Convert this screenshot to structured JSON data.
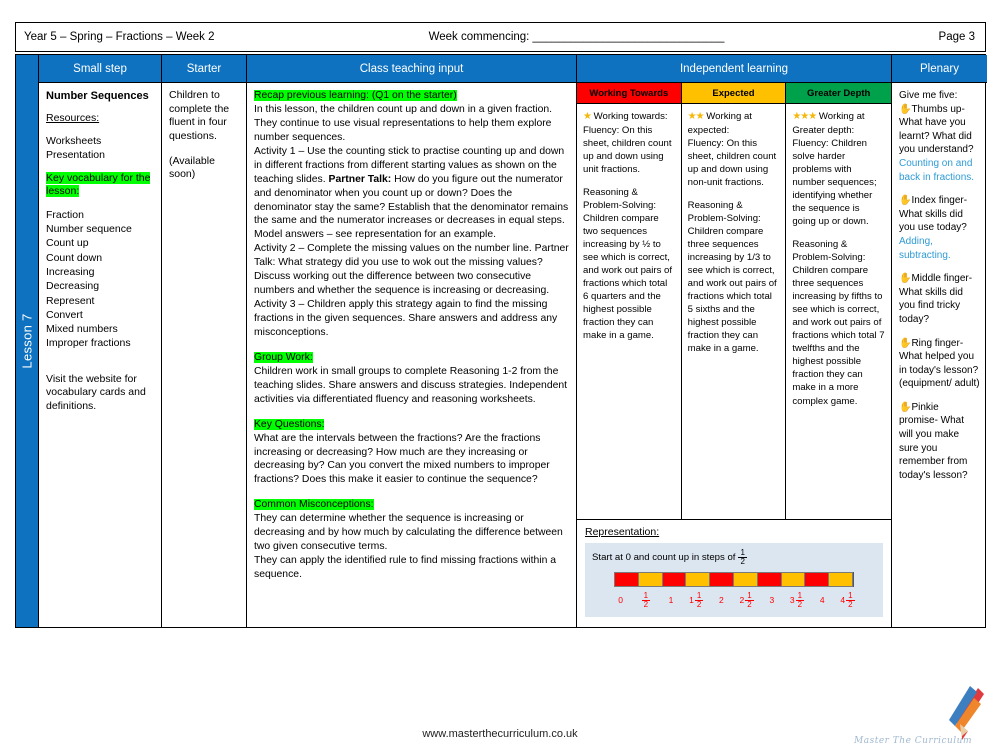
{
  "header": {
    "title": "Year 5 – Spring – Fractions – Week 2",
    "week_commencing": "Week commencing: ______________________________",
    "page": "Page 3"
  },
  "lesson_tab": "Lesson 7",
  "columns": {
    "small_step": "Small step",
    "starter": "Starter",
    "class_teaching_input": "Class teaching input",
    "independent_learning": "Independent learning",
    "plenary": "Plenary"
  },
  "small_step": {
    "title": "Number Sequences",
    "resources_label": "Resources:",
    "resources": [
      "Worksheets",
      "Presentation"
    ],
    "key_vocab_label": "Key vocabulary for the lesson:",
    "vocabulary": [
      "Fraction",
      "Number sequence",
      "Count up",
      "Count down",
      "Increasing",
      "Decreasing",
      "Represent",
      "Convert",
      "Mixed numbers",
      "Improper fractions"
    ],
    "visit_note": "Visit the website for vocabulary cards and definitions."
  },
  "starter": {
    "line1": "Children to complete the fluent in four questions.",
    "line2": "(Available soon)"
  },
  "class_teaching_input": {
    "recap_label": "Recap previous learning: (Q1 on the starter)",
    "intro": "In this lesson, the children count up and down in a given fraction. They continue to use visual representations to help them explore number sequences.",
    "activity1_a": "Activity 1 – Use the counting stick to practise counting up and down in different fractions from different starting values as shown on the teaching slides. ",
    "activity1_bold": "Partner Talk:",
    "activity1_b": " How do you figure out the numerator and denominator when you count up or down? Does the denominator stay the same? Establish that the denominator remains the same and the numerator increases or decreases in equal steps.",
    "model_answers": "Model answers – see representation for an example.",
    "activity2": "Activity 2 – Complete the missing values on the number line. Partner Talk: What strategy did you use to wok out the missing values? Discuss working out the difference between two consecutive numbers and whether the sequence is increasing or decreasing.",
    "activity3": "Activity 3 – Children apply this strategy again to find the missing fractions in the given sequences. Share answers and address any misconceptions.",
    "group_work_label": "Group Work:",
    "group_work": "Children work in small groups to complete Reasoning 1-2 from the teaching slides. Share answers and discuss strategies. Independent activities via differentiated fluency and reasoning worksheets.",
    "key_questions_label": "Key Questions:",
    "key_questions": "What are the intervals between the fractions? Are the fractions increasing or decreasing? How much are they increasing or decreasing by? Can you convert the mixed numbers to improper fractions? Does this make it easier to continue the sequence?",
    "misconceptions_label": "Common Misconceptions:",
    "misconceptions_1": "They can determine whether the sequence is increasing or decreasing and by how much by calculating the difference between two given consecutive terms.",
    "misconceptions_2": "They can apply the identified rule to find missing fractions within a sequence."
  },
  "independent_learning": {
    "columns": [
      {
        "header": "Working Towards",
        "header_bg": "#FF0000",
        "stars": "★",
        "heading": "Working towards:",
        "fluency": "Fluency: On this sheet, children count up and down using unit fractions.",
        "reasoning": "Reasoning & Problem-Solving: Children compare two sequences increasing by ½ to see which is correct, and work out pairs of fractions which total 6 quarters and the highest possible fraction they can make in a game."
      },
      {
        "header": "Expected",
        "header_bg": "#FFC000",
        "stars": "★★",
        "heading": "Working at expected:",
        "fluency": "Fluency: On this sheet, children count up and down using non-unit fractions.",
        "reasoning": "Reasoning & Problem-Solving: Children compare three sequences increasing by 1/3 to see which is correct, and work out pairs of fractions which total 5 sixths and the highest possible fraction they can make in a game."
      },
      {
        "header": "Greater Depth",
        "header_bg": "#00A14B",
        "stars": "★★★",
        "heading": "Working at Greater depth:",
        "fluency": "Fluency: Children solve harder problems with number sequences; identifying whether the sequence is going up or down.",
        "reasoning": "Reasoning & Problem-Solving: Children compare three sequences increasing by fifths to see which is correct, and work out pairs of fractions which total 7 twelfths and the highest possible fraction they can make in a more complex game."
      }
    ]
  },
  "representation": {
    "title": "Representation:",
    "caption_prefix": "Start at 0 and count up in steps of",
    "step_numerator": "1",
    "step_denominator": "2",
    "segments": [
      "r",
      "y",
      "r",
      "y",
      "r",
      "y",
      "r",
      "y",
      "r",
      "y"
    ],
    "segment_colors": {
      "r": "#FF0000",
      "y": "#FFC000"
    },
    "tick_labels": [
      {
        "whole": "0",
        "num": "",
        "den": ""
      },
      {
        "whole": "",
        "num": "1",
        "den": "2"
      },
      {
        "whole": "1",
        "num": "",
        "den": ""
      },
      {
        "whole": "1",
        "num": "1",
        "den": "2"
      },
      {
        "whole": "2",
        "num": "",
        "den": ""
      },
      {
        "whole": "2",
        "num": "1",
        "den": "2"
      },
      {
        "whole": "3",
        "num": "",
        "den": ""
      },
      {
        "whole": "3",
        "num": "1",
        "den": "2"
      },
      {
        "whole": "4",
        "num": "",
        "den": ""
      },
      {
        "whole": "4",
        "num": "1",
        "den": "2"
      }
    ]
  },
  "plenary": {
    "title": "Give me five:",
    "items": [
      {
        "hand": "✋",
        "question": "Thumbs up- What have you learnt? What did you understand?",
        "answer": "Counting on and back in fractions."
      },
      {
        "hand": "✋",
        "question": "Index finger- What skills did you use today?",
        "answer": "Adding, subtracting."
      },
      {
        "hand": "✋",
        "question": "Middle finger- What skills did you find tricky today?",
        "answer": ""
      },
      {
        "hand": "✋",
        "question": "Ring finger- What helped you in today's lesson? (equipment/ adult)",
        "answer": ""
      },
      {
        "hand": "✋",
        "question": "Pinkie promise- What will you make sure you remember from today's lesson?",
        "answer": ""
      }
    ]
  },
  "footer": {
    "url": "www.masterthecurriculum.co.uk",
    "logo_text": "Master The Curriculum"
  },
  "colors": {
    "brand_blue": "#0E72C0",
    "highlight_green": "#00FF00",
    "red": "#FF0000",
    "amber": "#FFC000",
    "green": "#00A14B",
    "panel_blue": "#DCE6F1"
  }
}
